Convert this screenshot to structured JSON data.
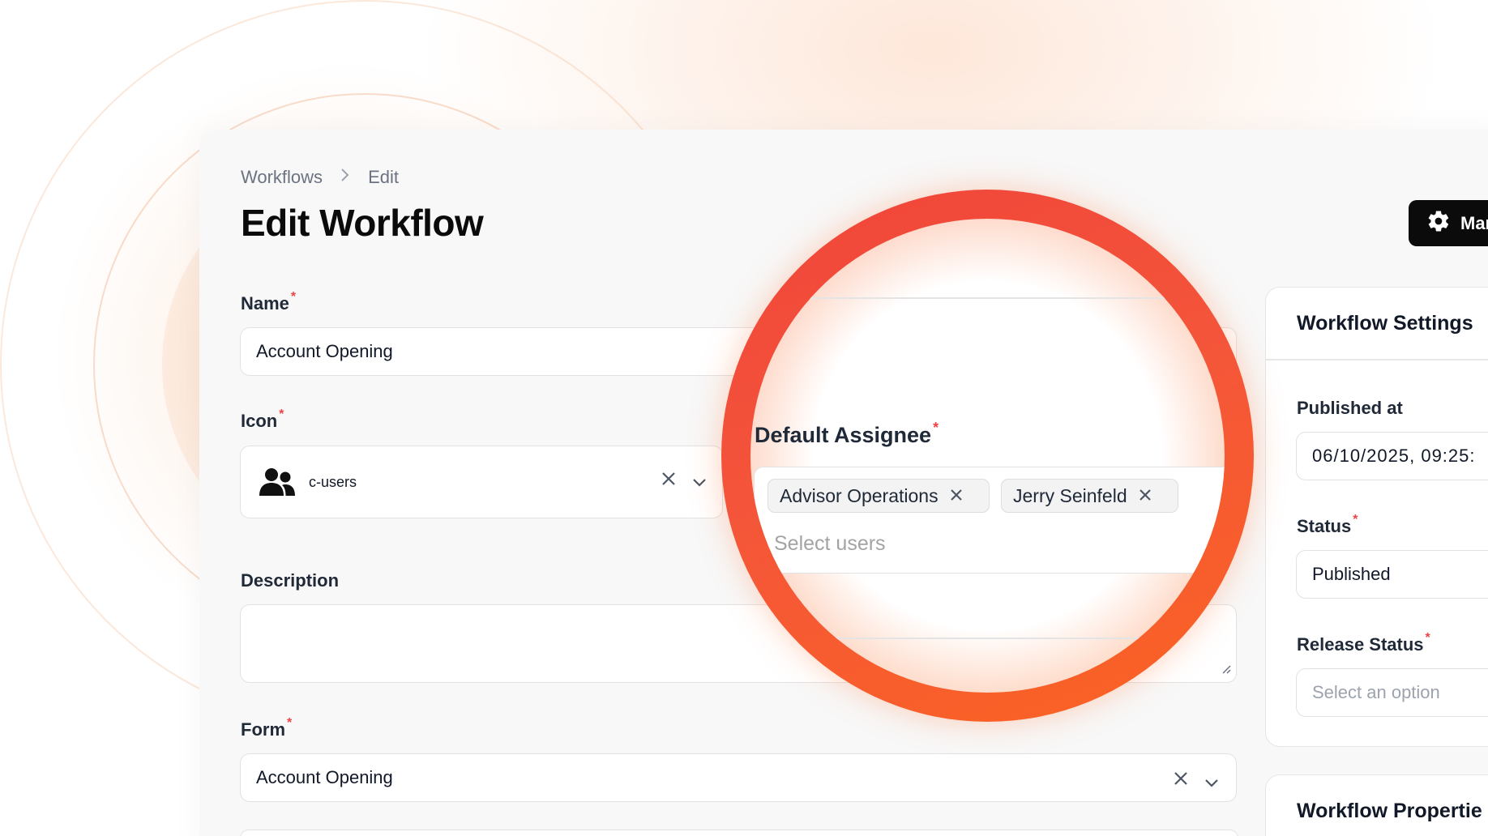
{
  "breadcrumb": {
    "root": "Workflows",
    "separator": "›",
    "current": "Edit"
  },
  "page": {
    "title": "Edit Workflow"
  },
  "header": {
    "manage_label": "Mar"
  },
  "form": {
    "name": {
      "label": "Name",
      "required": "*",
      "value": "Account Opening"
    },
    "icon": {
      "label": "Icon",
      "required": "*",
      "value": "c-users"
    },
    "description": {
      "label": "Description",
      "value": ""
    },
    "form_select": {
      "label": "Form",
      "required": "*",
      "value": "Account Opening"
    },
    "default_assignee": {
      "label": "Default Assignee",
      "required": "*",
      "chips": [
        "Advisor Operations",
        "Jerry Seinfeld"
      ],
      "placeholder": "Select users"
    }
  },
  "settings": {
    "title": "Workflow Settings",
    "published_at": {
      "label": "Published at",
      "value": "06/10/2025, 09:25:"
    },
    "status": {
      "label": "Status",
      "required": "*",
      "value": "Published"
    },
    "release_status": {
      "label": "Release Status",
      "required": "*",
      "placeholder": "Select an option"
    }
  },
  "properties": {
    "title": "Workflow Propertie"
  },
  "icons": {
    "clear": "×",
    "chevron": "⌄",
    "users": "c-users-icon",
    "gear": "gear-icon"
  },
  "colors": {
    "accent_ring_start": "#f0443a",
    "accent_ring_end": "#fb6422",
    "button_bg": "#0b0b0b",
    "required": "#ef4444"
  }
}
